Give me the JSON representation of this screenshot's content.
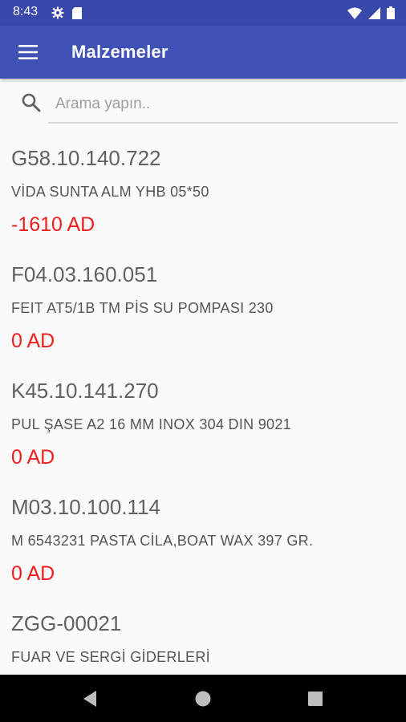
{
  "status_bar": {
    "time": "8:43",
    "icons": [
      "gear-icon",
      "sd-card-icon",
      "wifi-icon",
      "signal-icon",
      "battery-icon"
    ]
  },
  "app_bar": {
    "title": "Malzemeler",
    "menu_icon": "hamburger-menu-icon",
    "color": "#3f51b5"
  },
  "search": {
    "placeholder": "Arama yapın..",
    "value": ""
  },
  "materials": [
    {
      "code": "G58.10.140.722",
      "name": "VİDA SUNTA ALM YHB 05*50",
      "quantity": "-1610 AD"
    },
    {
      "code": "F04.03.160.051",
      "name": "FEIT AT5/1B TM PİS SU POMPASI 230",
      "quantity": "0 AD"
    },
    {
      "code": "K45.10.141.270",
      "name": "PUL ŞASE A2 16 MM INOX 304 DIN 9021",
      "quantity": "0 AD"
    },
    {
      "code": "M03.10.100.114",
      "name": "M 6543231 PASTA CİLA,BOAT WAX 397 GR.",
      "quantity": "0 AD"
    },
    {
      "code": "ZGG-00021",
      "name": "FUAR VE SERGİ GİDERLERİ",
      "quantity": ""
    }
  ],
  "nav_bar": {
    "buttons": [
      "back-icon",
      "home-icon",
      "recents-icon"
    ]
  },
  "colors": {
    "status_bar": "#3949ab",
    "app_bar": "#3f51b5",
    "quantity_text": "#f01d1d"
  }
}
